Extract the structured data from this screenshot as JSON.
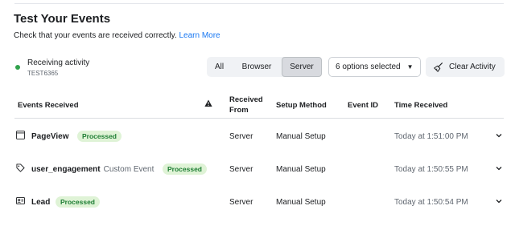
{
  "page": {
    "title": "Test Your Events",
    "subtitle": "Check that your events are received correctly.",
    "learn_more": "Learn More"
  },
  "status": {
    "label": "Receiving activity",
    "test_code": "TEST6365",
    "color": "#31a24c"
  },
  "filters": {
    "tabs": [
      {
        "label": "All",
        "selected": false
      },
      {
        "label": "Browser",
        "selected": false
      },
      {
        "label": "Server",
        "selected": true
      }
    ],
    "options_dropdown": "6 options selected",
    "clear_button": "Clear Activity"
  },
  "table": {
    "headers": {
      "events_received": "Events Received",
      "received_from": "Received From",
      "setup_method": "Setup Method",
      "event_id": "Event ID",
      "time_received": "Time Received"
    },
    "rows": [
      {
        "icon": "page-icon",
        "event": "PageView",
        "type": "",
        "status": "Processed",
        "received_from": "Server",
        "setup_method": "Manual Setup",
        "event_id": "",
        "time": "Today at 1:51:00 PM"
      },
      {
        "icon": "tag-icon",
        "event": "user_engagement",
        "type": "Custom Event",
        "status": "Processed",
        "received_from": "Server",
        "setup_method": "Manual Setup",
        "event_id": "",
        "time": "Today at 1:50:55 PM"
      },
      {
        "icon": "contact-card-icon",
        "event": "Lead",
        "type": "",
        "status": "Processed",
        "received_from": "Server",
        "setup_method": "Manual Setup",
        "event_id": "",
        "time": "Today at 1:50:54 PM"
      }
    ]
  },
  "colors": {
    "link": "#1877f2",
    "badge_bg": "#dff3d6",
    "badge_text": "#1e7e34"
  }
}
